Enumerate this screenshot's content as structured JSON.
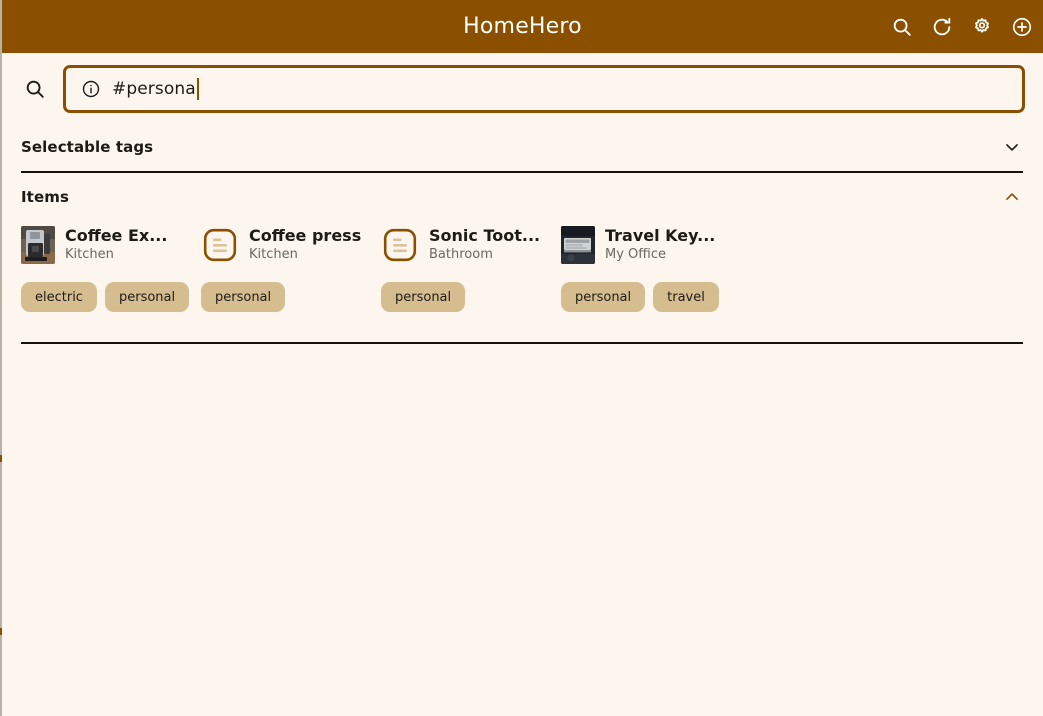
{
  "colors": {
    "appbar_bg": "#8a5000",
    "page_bg": "#fcf6ef",
    "accent": "#8a5000",
    "tag_chip_bg": "#d6bd90",
    "text_primary": "#1d1b16",
    "text_secondary": "#6c6760",
    "divider": "#17130b"
  },
  "appbar": {
    "title": "HomeHero",
    "actions": [
      {
        "name": "search-icon",
        "label": "Search"
      },
      {
        "name": "refresh-icon",
        "label": "Refresh"
      },
      {
        "name": "gear-icon",
        "label": "Settings"
      },
      {
        "name": "add-circle-icon",
        "label": "Add"
      }
    ]
  },
  "search": {
    "leading_icon": "search-icon",
    "info_icon": "info-icon",
    "value": "#persona",
    "placeholder": "Search",
    "caret_visible": true
  },
  "sections": [
    {
      "id": "selectable-tags",
      "title": "Selectable tags",
      "expanded": false,
      "chevron": "chevron-down-icon"
    },
    {
      "id": "items",
      "title": "Items",
      "expanded": true,
      "chevron": "chevron-up-icon"
    }
  ],
  "items": [
    {
      "title": "Coffee Ex...",
      "location": "Kitchen",
      "thumbnail": "photo",
      "thumb_kind": "coffee-machine-photo",
      "tags": [
        "electric",
        "personal"
      ]
    },
    {
      "title": "Coffee press",
      "location": "Kitchen",
      "thumbnail": "placeholder",
      "thumb_kind": "document-placeholder-icon",
      "tags": [
        "personal"
      ]
    },
    {
      "title": "Sonic Toot...",
      "location": "Bathroom",
      "thumbnail": "placeholder",
      "thumb_kind": "document-placeholder-icon",
      "tags": [
        "personal"
      ]
    },
    {
      "title": "Travel Key...",
      "location": "My Office",
      "thumbnail": "photo",
      "thumb_kind": "keyboard-photo",
      "tags": [
        "personal",
        "travel"
      ]
    }
  ]
}
